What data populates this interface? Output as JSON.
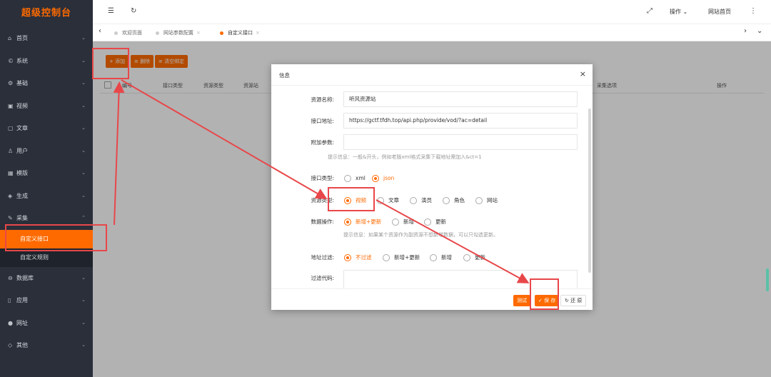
{
  "sidebar": {
    "brand": "超级控制台",
    "items": [
      {
        "icon": "home-icon",
        "glyph": "⌂",
        "label": "首页"
      },
      {
        "icon": "system-icon",
        "glyph": "©",
        "label": "系统"
      },
      {
        "icon": "gear-icon",
        "glyph": "⚙",
        "label": "基础"
      },
      {
        "icon": "video-icon",
        "glyph": "▣",
        "label": "视频"
      },
      {
        "icon": "document-icon",
        "glyph": "▢",
        "label": "文章"
      },
      {
        "icon": "user-icon",
        "glyph": "♙",
        "label": "用户"
      },
      {
        "icon": "template-icon",
        "glyph": "▦",
        "label": "模版"
      },
      {
        "icon": "generate-icon",
        "glyph": "◈",
        "label": "生成"
      },
      {
        "icon": "collect-icon",
        "glyph": "✎",
        "label": "采集",
        "expanded": true,
        "children": [
          {
            "label": "自定义接口",
            "active": true
          },
          {
            "label": "自定义规则"
          }
        ]
      },
      {
        "icon": "database-icon",
        "glyph": "⊖",
        "label": "数据库"
      },
      {
        "icon": "app-icon",
        "glyph": "▯",
        "label": "应用"
      },
      {
        "icon": "globe-icon",
        "glyph": "●",
        "label": "网址"
      },
      {
        "icon": "tag-icon",
        "glyph": "◇",
        "label": "其他"
      }
    ]
  },
  "topbar": {
    "menu_icon": "☰",
    "refresh_icon": "↻",
    "fullscreen_icon": "⤢",
    "operate_label": "操作",
    "site_home_label": "网站首页",
    "more_icon": "⋮"
  },
  "tabs": {
    "prev_icon": "‹",
    "next_icon": "›",
    "items": [
      {
        "label": "欢迎页面"
      },
      {
        "label": "网站参数配置",
        "close": "×"
      },
      {
        "label": "自定义接口",
        "close": "×",
        "active": true
      }
    ]
  },
  "toolbar": {
    "add_label": "+ 添加",
    "delete_label": "≡ 删除",
    "clear_label": "≡ 清空绑定"
  },
  "table": {
    "headers": [
      "编号",
      "接口类型",
      "资源类型",
      "资源站",
      "采集选项",
      "操作"
    ]
  },
  "modal": {
    "title": "信息",
    "close_icon": "×",
    "fields": {
      "name_label": "资源名称:",
      "name_value": "听风资源站",
      "url_label": "接口地址:",
      "url_value": "https://gctf.tfdh.top/api.php/provide/vod/?ac=detail",
      "param_label": "附加参数:",
      "param_value": "",
      "param_tip": "提示信息：一般&开头，例如老版xml格式采集下载地址需加入&ct=1",
      "interface_type_label": "接口类型:",
      "interface_type_options": [
        "xml",
        "json"
      ],
      "interface_type_selected": "json",
      "resource_type_label": "资源类型:",
      "resource_type_options": [
        "视频",
        "文章",
        "演员",
        "角色",
        "网站"
      ],
      "resource_type_selected": "视频",
      "data_op_label": "数据操作:",
      "data_op_options": [
        "新增+更新",
        "新增",
        "更新"
      ],
      "data_op_selected": "新增+更新",
      "data_op_tip": "提示信息：如果某个资源作为副资源不想新增数据，可以只勾选更新。",
      "url_filter_label": "地址过滤:",
      "url_filter_options": [
        "不过滤",
        "新增+更新",
        "新增",
        "更新"
      ],
      "url_filter_selected": "不过滤",
      "filter_code_label": "过滤代码:"
    },
    "buttons": {
      "test_label": "测试",
      "save_label": "✓ 保 存",
      "reset_label": "↻ 还 原"
    }
  },
  "colors": {
    "accent": "#ff6a00",
    "sidebar_bg": "#2a2f3a",
    "annotation": "#e8474a"
  }
}
